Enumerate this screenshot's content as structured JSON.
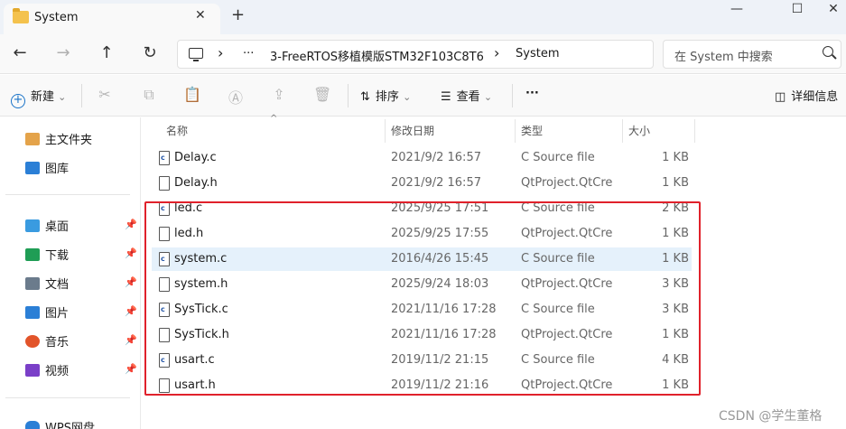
{
  "window": {
    "tab_title": "System",
    "close_tab_glyph": "✕",
    "new_tab_glyph": "+",
    "minimize_glyph": "—",
    "maximize_glyph": "☐",
    "close_glyph": "✕"
  },
  "nav": {
    "back_glyph": "←",
    "forward_glyph": "→",
    "up_glyph": "↑",
    "refresh_glyph": "↻",
    "breadcrumb": [
      "3-FreeRTOS移植模版STM32F103C8T6",
      "System"
    ],
    "chevron": "›",
    "ellipsis": "···",
    "search_placeholder": "在 System 中搜索"
  },
  "toolbar": {
    "new_label": "新建",
    "sort_label": "排序",
    "view_label": "查看",
    "more_label": "···",
    "details_label": "详细信息",
    "dropdown_glyph": "⌄"
  },
  "sidebar": {
    "quick": [
      {
        "label": "主文件夹",
        "icon": "home-icon",
        "color": "#e4a34a"
      },
      {
        "label": "图库",
        "icon": "gallery-icon",
        "color": "#2b7fd6"
      }
    ],
    "pinned": [
      {
        "label": "桌面",
        "icon": "desktop-icon",
        "color": "#3a9be0"
      },
      {
        "label": "下载",
        "icon": "download-icon",
        "color": "#1f9d55"
      },
      {
        "label": "文档",
        "icon": "documents-icon",
        "color": "#6b7b8c"
      },
      {
        "label": "图片",
        "icon": "pictures-icon",
        "color": "#2b7fd6"
      },
      {
        "label": "音乐",
        "icon": "music-icon",
        "color": "#e2542a"
      },
      {
        "label": "视频",
        "icon": "video-icon",
        "color": "#7a3fc8"
      }
    ],
    "pin_glyph": "📌",
    "cloud": {
      "label": "WPS网盘",
      "icon": "cloud-icon",
      "color": "#2b7fd6"
    }
  },
  "columns": {
    "name": "名称",
    "date": "修改日期",
    "type": "类型",
    "size": "大小",
    "sort_glyph": "^"
  },
  "files": [
    {
      "name": "Delay.c",
      "date": "2021/9/2 16:57",
      "type": "C Source file",
      "size": "1 KB",
      "kind": "c"
    },
    {
      "name": "Delay.h",
      "date": "2021/9/2 16:57",
      "type": "QtProject.QtCre...",
      "size": "1 KB",
      "kind": "h"
    },
    {
      "name": "led.c",
      "date": "2025/9/25 17:51",
      "type": "C Source file",
      "size": "2 KB",
      "kind": "c"
    },
    {
      "name": "led.h",
      "date": "2025/9/25 17:55",
      "type": "QtProject.QtCre...",
      "size": "1 KB",
      "kind": "h"
    },
    {
      "name": "system.c",
      "date": "2016/4/26 15:45",
      "type": "C Source file",
      "size": "1 KB",
      "kind": "c",
      "selected": true
    },
    {
      "name": "system.h",
      "date": "2025/9/24 18:03",
      "type": "QtProject.QtCre...",
      "size": "3 KB",
      "kind": "h"
    },
    {
      "name": "SysTick.c",
      "date": "2021/11/16 17:28",
      "type": "C Source file",
      "size": "3 KB",
      "kind": "c"
    },
    {
      "name": "SysTick.h",
      "date": "2021/11/16 17:28",
      "type": "QtProject.QtCre...",
      "size": "1 KB",
      "kind": "h"
    },
    {
      "name": "usart.c",
      "date": "2019/11/2 21:15",
      "type": "C Source file",
      "size": "4 KB",
      "kind": "c"
    },
    {
      "name": "usart.h",
      "date": "2019/11/2 21:16",
      "type": "QtProject.QtCre...",
      "size": "1 KB",
      "kind": "h"
    }
  ],
  "watermark": "CSDN @学生董格"
}
